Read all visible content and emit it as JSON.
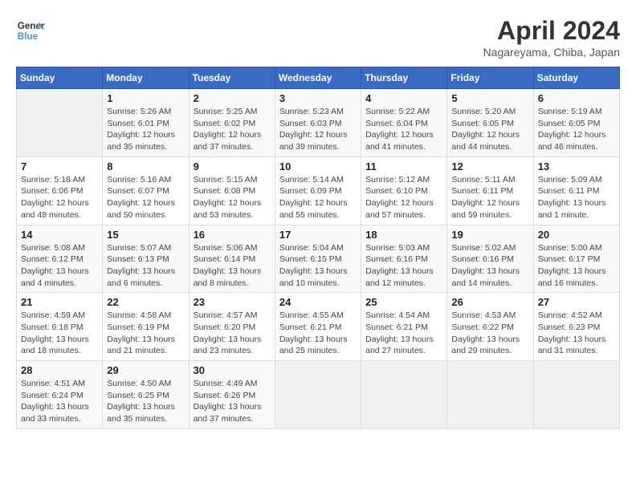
{
  "header": {
    "logo_line1": "General",
    "logo_line2": "Blue",
    "month": "April 2024",
    "location": "Nagareyama, Chiba, Japan"
  },
  "weekdays": [
    "Sunday",
    "Monday",
    "Tuesday",
    "Wednesday",
    "Thursday",
    "Friday",
    "Saturday"
  ],
  "weeks": [
    [
      {
        "day": "",
        "info": ""
      },
      {
        "day": "1",
        "info": "Sunrise: 5:26 AM\nSunset: 6:01 PM\nDaylight: 12 hours\nand 35 minutes."
      },
      {
        "day": "2",
        "info": "Sunrise: 5:25 AM\nSunset: 6:02 PM\nDaylight: 12 hours\nand 37 minutes."
      },
      {
        "day": "3",
        "info": "Sunrise: 5:23 AM\nSunset: 6:03 PM\nDaylight: 12 hours\nand 39 minutes."
      },
      {
        "day": "4",
        "info": "Sunrise: 5:22 AM\nSunset: 6:04 PM\nDaylight: 12 hours\nand 41 minutes."
      },
      {
        "day": "5",
        "info": "Sunrise: 5:20 AM\nSunset: 6:05 PM\nDaylight: 12 hours\nand 44 minutes."
      },
      {
        "day": "6",
        "info": "Sunrise: 5:19 AM\nSunset: 6:05 PM\nDaylight: 12 hours\nand 46 minutes."
      }
    ],
    [
      {
        "day": "7",
        "info": "Sunrise: 5:18 AM\nSunset: 6:06 PM\nDaylight: 12 hours\nand 48 minutes."
      },
      {
        "day": "8",
        "info": "Sunrise: 5:16 AM\nSunset: 6:07 PM\nDaylight: 12 hours\nand 50 minutes."
      },
      {
        "day": "9",
        "info": "Sunrise: 5:15 AM\nSunset: 6:08 PM\nDaylight: 12 hours\nand 53 minutes."
      },
      {
        "day": "10",
        "info": "Sunrise: 5:14 AM\nSunset: 6:09 PM\nDaylight: 12 hours\nand 55 minutes."
      },
      {
        "day": "11",
        "info": "Sunrise: 5:12 AM\nSunset: 6:10 PM\nDaylight: 12 hours\nand 57 minutes."
      },
      {
        "day": "12",
        "info": "Sunrise: 5:11 AM\nSunset: 6:11 PM\nDaylight: 12 hours\nand 59 minutes."
      },
      {
        "day": "13",
        "info": "Sunrise: 5:09 AM\nSunset: 6:11 PM\nDaylight: 13 hours\nand 1 minute."
      }
    ],
    [
      {
        "day": "14",
        "info": "Sunrise: 5:08 AM\nSunset: 6:12 PM\nDaylight: 13 hours\nand 4 minutes."
      },
      {
        "day": "15",
        "info": "Sunrise: 5:07 AM\nSunset: 6:13 PM\nDaylight: 13 hours\nand 6 minutes."
      },
      {
        "day": "16",
        "info": "Sunrise: 5:06 AM\nSunset: 6:14 PM\nDaylight: 13 hours\nand 8 minutes."
      },
      {
        "day": "17",
        "info": "Sunrise: 5:04 AM\nSunset: 6:15 PM\nDaylight: 13 hours\nand 10 minutes."
      },
      {
        "day": "18",
        "info": "Sunrise: 5:03 AM\nSunset: 6:16 PM\nDaylight: 13 hours\nand 12 minutes."
      },
      {
        "day": "19",
        "info": "Sunrise: 5:02 AM\nSunset: 6:16 PM\nDaylight: 13 hours\nand 14 minutes."
      },
      {
        "day": "20",
        "info": "Sunrise: 5:00 AM\nSunset: 6:17 PM\nDaylight: 13 hours\nand 16 minutes."
      }
    ],
    [
      {
        "day": "21",
        "info": "Sunrise: 4:59 AM\nSunset: 6:18 PM\nDaylight: 13 hours\nand 18 minutes."
      },
      {
        "day": "22",
        "info": "Sunrise: 4:58 AM\nSunset: 6:19 PM\nDaylight: 13 hours\nand 21 minutes."
      },
      {
        "day": "23",
        "info": "Sunrise: 4:57 AM\nSunset: 6:20 PM\nDaylight: 13 hours\nand 23 minutes."
      },
      {
        "day": "24",
        "info": "Sunrise: 4:55 AM\nSunset: 6:21 PM\nDaylight: 13 hours\nand 25 minutes."
      },
      {
        "day": "25",
        "info": "Sunrise: 4:54 AM\nSunset: 6:21 PM\nDaylight: 13 hours\nand 27 minutes."
      },
      {
        "day": "26",
        "info": "Sunrise: 4:53 AM\nSunset: 6:22 PM\nDaylight: 13 hours\nand 29 minutes."
      },
      {
        "day": "27",
        "info": "Sunrise: 4:52 AM\nSunset: 6:23 PM\nDaylight: 13 hours\nand 31 minutes."
      }
    ],
    [
      {
        "day": "28",
        "info": "Sunrise: 4:51 AM\nSunset: 6:24 PM\nDaylight: 13 hours\nand 33 minutes."
      },
      {
        "day": "29",
        "info": "Sunrise: 4:50 AM\nSunset: 6:25 PM\nDaylight: 13 hours\nand 35 minutes."
      },
      {
        "day": "30",
        "info": "Sunrise: 4:49 AM\nSunset: 6:26 PM\nDaylight: 13 hours\nand 37 minutes."
      },
      {
        "day": "",
        "info": ""
      },
      {
        "day": "",
        "info": ""
      },
      {
        "day": "",
        "info": ""
      },
      {
        "day": "",
        "info": ""
      }
    ]
  ]
}
